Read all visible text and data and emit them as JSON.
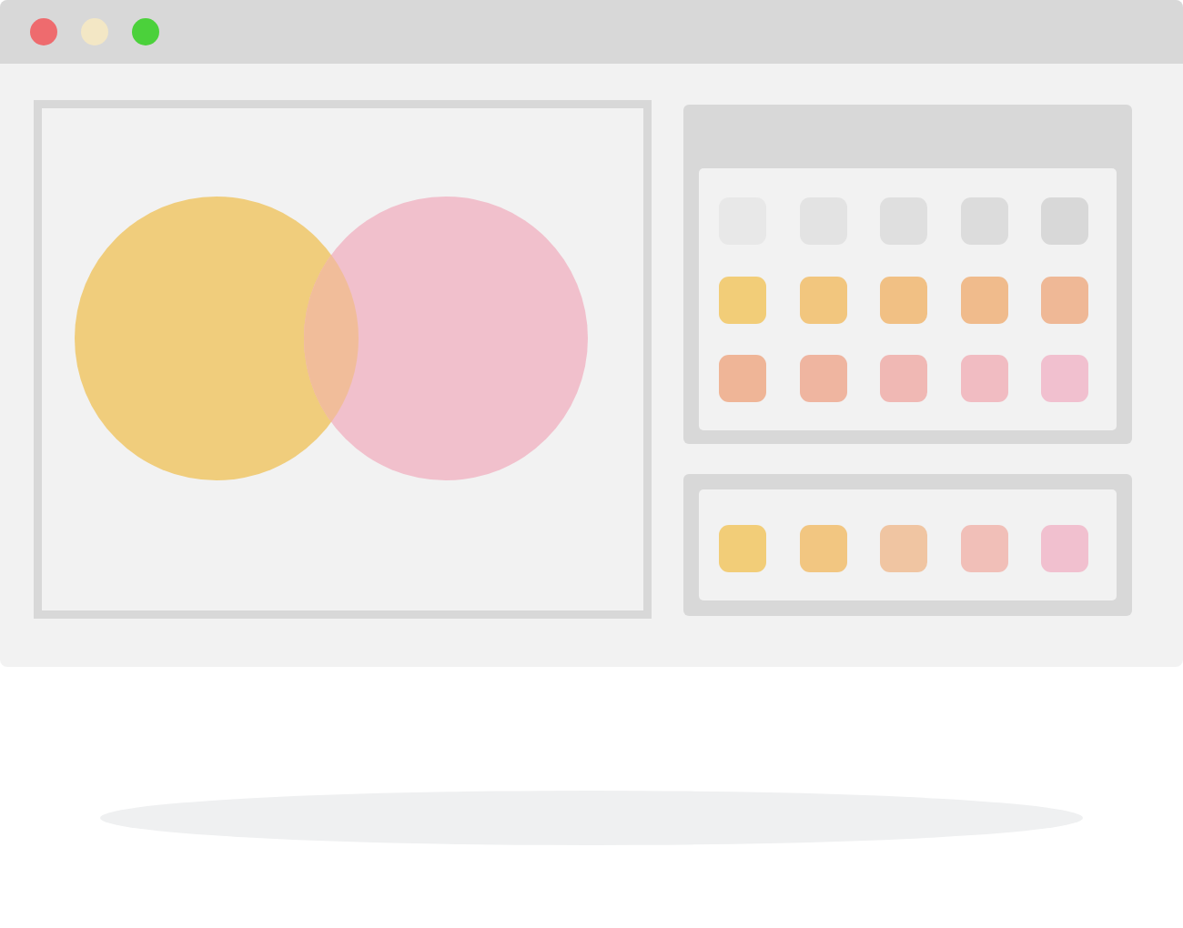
{
  "window": {
    "controls": [
      {
        "color": "#ee6b6e"
      },
      {
        "color": "#f3e7c5"
      },
      {
        "color": "#4bd13b"
      }
    ]
  },
  "canvas": {
    "circles": [
      {
        "color": "#f0cd7c"
      },
      {
        "color": "#f1c0cc"
      }
    ]
  },
  "palette": {
    "rows": [
      {
        "swatches": [
          {
            "color": "#e8e8e8"
          },
          {
            "color": "#e3e3e3"
          },
          {
            "color": "#dfdfdf"
          },
          {
            "color": "#dcdcdc"
          },
          {
            "color": "#d8d8d8"
          }
        ]
      },
      {
        "swatches": [
          {
            "color": "#f2cd78"
          },
          {
            "color": "#f2c67e"
          },
          {
            "color": "#f1c084"
          },
          {
            "color": "#f0bb8c"
          },
          {
            "color": "#efb896"
          }
        ]
      },
      {
        "swatches": [
          {
            "color": "#efb597"
          },
          {
            "color": "#efb5a0"
          },
          {
            "color": "#f0b8b4"
          },
          {
            "color": "#f1bcc2"
          },
          {
            "color": "#f1c0cf"
          }
        ]
      }
    ]
  },
  "swatch_bar": {
    "swatches": [
      {
        "color": "#f2cd78"
      },
      {
        "color": "#f2c681"
      },
      {
        "color": "#f0c5a2"
      },
      {
        "color": "#f1bfb8"
      },
      {
        "color": "#f1c0cf"
      }
    ]
  }
}
